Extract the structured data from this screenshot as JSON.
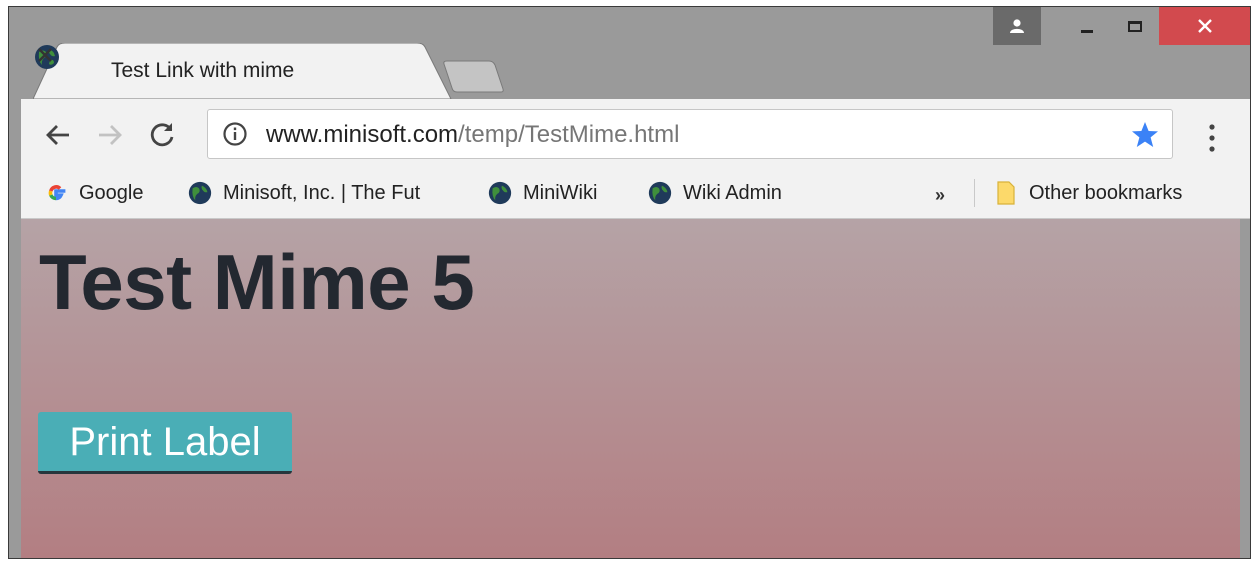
{
  "tab": {
    "title": "Test Link with mime",
    "favicon": "globe-icon",
    "close": "close-icon"
  },
  "toolbar": {
    "back": "back-arrow-icon",
    "forward": "forward-arrow-icon",
    "reload": "reload-icon",
    "url_host": "www.minisoft.com",
    "url_path": "/temp/TestMime.html",
    "security_icon": "info-icon",
    "bookmark_star_color": "#3b82f6"
  },
  "bookmarks": {
    "items": [
      {
        "label": "Google",
        "icon": "google-icon"
      },
      {
        "label": "Minisoft, Inc. | The Fut",
        "icon": "globe-icon"
      },
      {
        "label": "MiniWiki",
        "icon": "globe-icon"
      },
      {
        "label": "Wiki Admin",
        "icon": "globe-icon"
      }
    ],
    "more": "»",
    "other": "Other bookmarks"
  },
  "page": {
    "heading": "Test Mime 5",
    "print_button": "Print Label",
    "button_color": "#4aaeb6",
    "background_top": "#b5a3a6",
    "background_bottom": "#b37e82"
  }
}
